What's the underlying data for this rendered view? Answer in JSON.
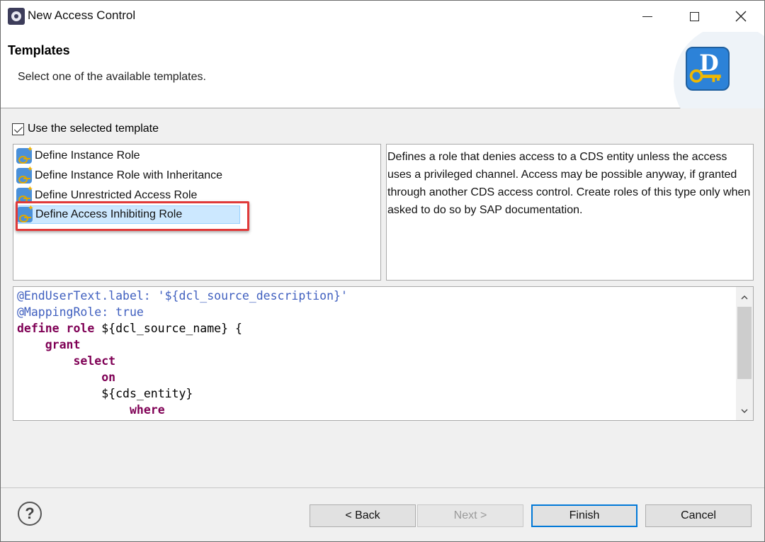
{
  "window": {
    "title": "New Access Control"
  },
  "header": {
    "title": "Templates",
    "description": "Select one of the available templates."
  },
  "use_template": {
    "label": "Use the selected template",
    "checked": true
  },
  "templates": {
    "items": [
      {
        "label": "Define Instance Role"
      },
      {
        "label": "Define Instance Role with Inheritance"
      },
      {
        "label": "Define Unrestricted Access Role"
      },
      {
        "label": "Define Access Inhibiting Role"
      }
    ],
    "selected_label": "Define Access Inhibiting Role"
  },
  "description": {
    "text": "Defines a role that denies access to a CDS entity unless the access uses a privileged channel. Access may be possible anyway, if granted through another CDS access control. Create roles of this type only when asked to do so by SAP documentation."
  },
  "code": {
    "line1": "@EndUserText.label: '${dcl_source_description}'",
    "line2": "@MappingRole: true",
    "line3_kw": "define role",
    "line3_rest": " ${dcl_source_name} {",
    "line4": "grant",
    "line5": "select",
    "line6": "on",
    "line7": "${cds_entity}",
    "line8": "where"
  },
  "buttons": {
    "back": "< Back",
    "next": "Next >",
    "finish": "Finish",
    "cancel": "Cancel",
    "help": "?"
  },
  "colors": {
    "annotation": "#3f5fbf",
    "keyword": "#7f0055",
    "selection": "#cce8ff",
    "highlight_box": "#e03a3a",
    "default_button_border": "#0078d7"
  }
}
